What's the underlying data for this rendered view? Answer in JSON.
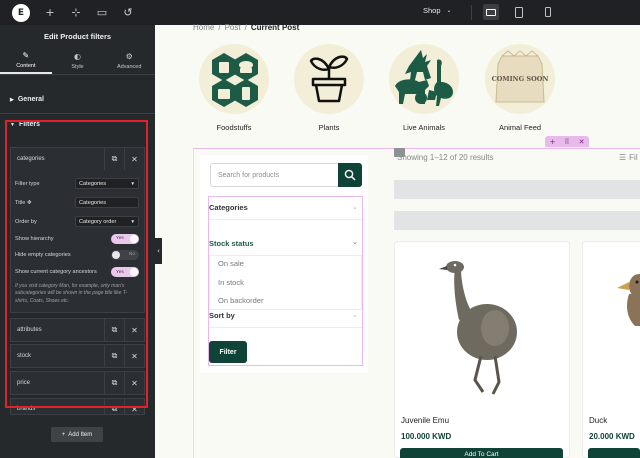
{
  "topbar": {
    "logo_letter": "E",
    "icons": [
      "plus-icon",
      "structure-icon",
      "page-settings-icon",
      "history-icon"
    ],
    "page_selector": "Shop",
    "devices": [
      "desktop",
      "tablet",
      "mobile"
    ]
  },
  "panel": {
    "title": "Edit Product filters",
    "tabs": [
      {
        "label": "Content",
        "icon": "pencil-icon"
      },
      {
        "label": "Style",
        "icon": "contrast-icon"
      },
      {
        "label": "Advanced",
        "icon": "gear-icon"
      }
    ],
    "general_label": "General",
    "filters_label": "Filters",
    "items": [
      "categories",
      "attributes",
      "stock",
      "price",
      "brands"
    ],
    "controls": {
      "filter_type_label": "Filter type",
      "filter_type_value": "Categories",
      "title_label": "Title",
      "title_value": "Categories",
      "order_by_label": "Order by",
      "order_by_value": "Category order",
      "show_hierarchy_label": "Show hierarchy",
      "show_hierarchy_value": "Yes",
      "hide_empty_label": "Hide empty categories",
      "hide_empty_value": "No",
      "show_ancestors_label": "Show current category ancestors",
      "show_ancestors_value": "Yes"
    },
    "note": "If you visit category Man, for example, only man's subcategories will be shown in the page title like T-shirts, Coats, Shoes etc.",
    "add_item_label": "Add Item"
  },
  "canvas": {
    "breadcrumb": [
      "Home",
      "Post",
      "Current Post"
    ],
    "categories": [
      {
        "label": "Foodstuffs"
      },
      {
        "label": "Plants"
      },
      {
        "label": "Live Animals"
      },
      {
        "label": "Animal Feed",
        "badge": "COMING SOON"
      }
    ],
    "search_placeholder": "Search for products",
    "filters": {
      "categories_title": "Categories",
      "stock_title": "Stock status",
      "stock_options": [
        "On sale",
        "In stock",
        "On backorder"
      ],
      "sort_title": "Sort by",
      "button_label": "Filter"
    },
    "results_text": "Showing 1–12 of 20 results",
    "filter_link": "Fil",
    "products": [
      {
        "name": "Juvenile Emu",
        "price": "100.000 KWD",
        "button": "Add To Cart"
      },
      {
        "name": "Duck",
        "price": "20.000 KWD"
      }
    ]
  },
  "colors": {
    "brand_green": "#0f4338",
    "highlight_red": "#e0232b",
    "toggle_pink": "#e9c8ec"
  }
}
